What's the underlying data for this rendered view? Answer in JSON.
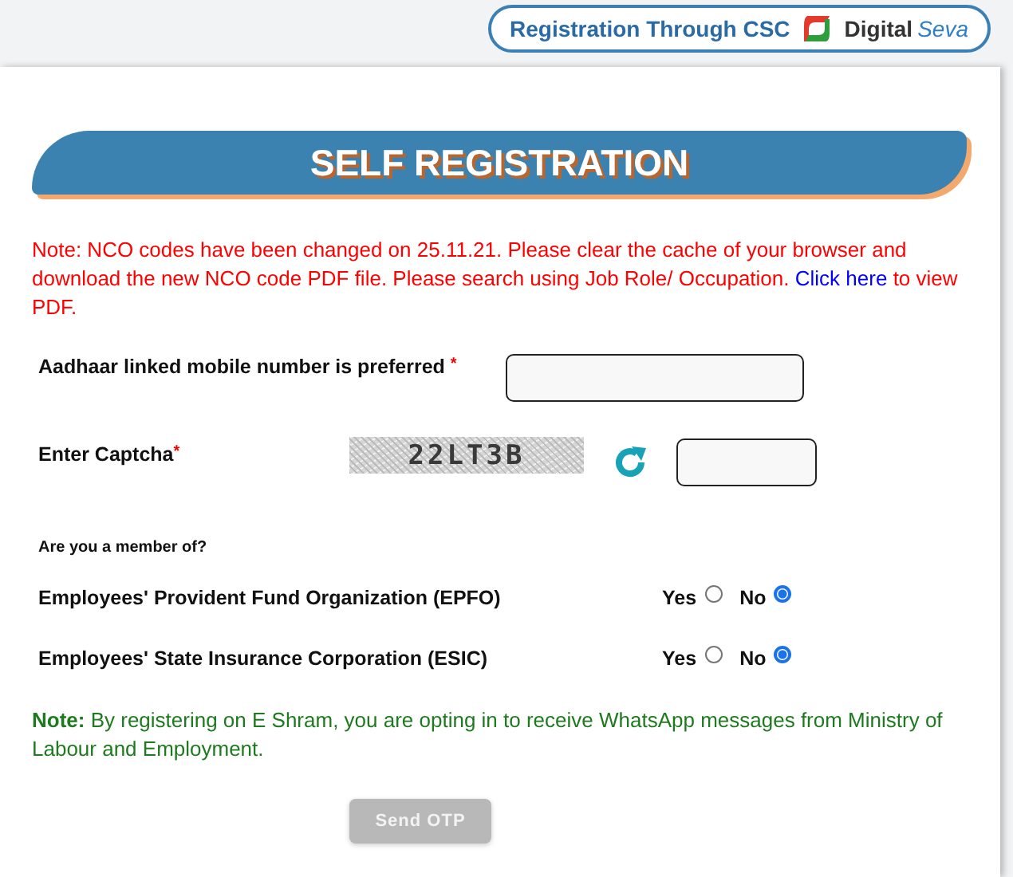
{
  "header_badge": {
    "label": "Registration Through CSC",
    "brand_main": "Digital",
    "brand_accent": "Seva"
  },
  "title": "SELF REGISTRATION",
  "notice": {
    "before": "Note: NCO codes have been changed on 25.11.21. Please clear the cache of your browser and download the new NCO code PDF file. Please search using Job Role/ Occupation.",
    "link": "Click here",
    "after": "to view PDF."
  },
  "mobile_field": {
    "label": "Aadhaar linked mobile number is preferred",
    "required_mark": "*"
  },
  "captcha": {
    "label": "Enter Captcha",
    "required_mark": "*",
    "code": "22LT3B"
  },
  "membership": {
    "question": "Are you a member of?",
    "rows": [
      {
        "label": "Employees' Provident Fund Organization (EPFO)",
        "options": [
          {
            "label": "Yes",
            "selected": false
          },
          {
            "label": "No",
            "selected": true
          }
        ]
      },
      {
        "label": "Employees' State Insurance Corporation (ESIC)",
        "options": [
          {
            "label": "Yes",
            "selected": false
          },
          {
            "label": "No",
            "selected": true
          }
        ]
      }
    ]
  },
  "consent_note": "**Note:** By registering on E Shram, you are opting in to receive WhatsApp messages from Ministry of Labour and Employment.",
  "submit": {
    "label": "Send OTP",
    "disabled": true
  }
}
